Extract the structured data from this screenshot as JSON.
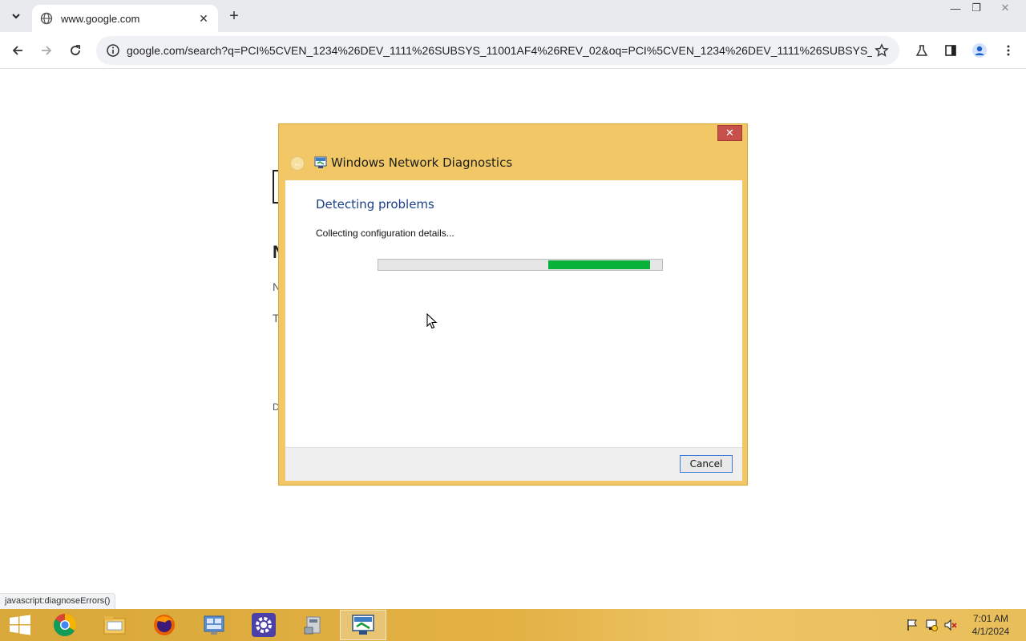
{
  "browser": {
    "tab_title": "www.google.com",
    "url": "google.com/search?q=PCI%5CVEN_1234%26DEV_1111%26SUBSYS_11001AF4%26REV_02&oq=PCI%5CVEN_1234%26DEV_1111%26SUBSYS_11001A...",
    "status_url": "javascript:diagnoseErrors()"
  },
  "page_ghost": {
    "letters": [
      "N",
      "N",
      "T",
      "D"
    ]
  },
  "dialog": {
    "title": "Windows Network Diagnostics",
    "heading": "Detecting problems",
    "status": "Collecting configuration details...",
    "progress_start": 0.6,
    "progress_end": 0.96,
    "cancel_label": "Cancel",
    "close_label": "✕"
  },
  "taskbar": {
    "apps": [
      "chrome-icon",
      "file-explorer-icon",
      "firefox-icon",
      "control-panel-icon",
      "settings-icon",
      "device-manager-icon",
      "network-diagnostics-icon"
    ],
    "time": "7:01 AM",
    "date": "4/1/2024"
  },
  "colors": {
    "dialog_frame": "#f1c865",
    "progress_fill": "#08b23a",
    "heading": "#1a3e8c",
    "close_red": "#c7504a"
  }
}
